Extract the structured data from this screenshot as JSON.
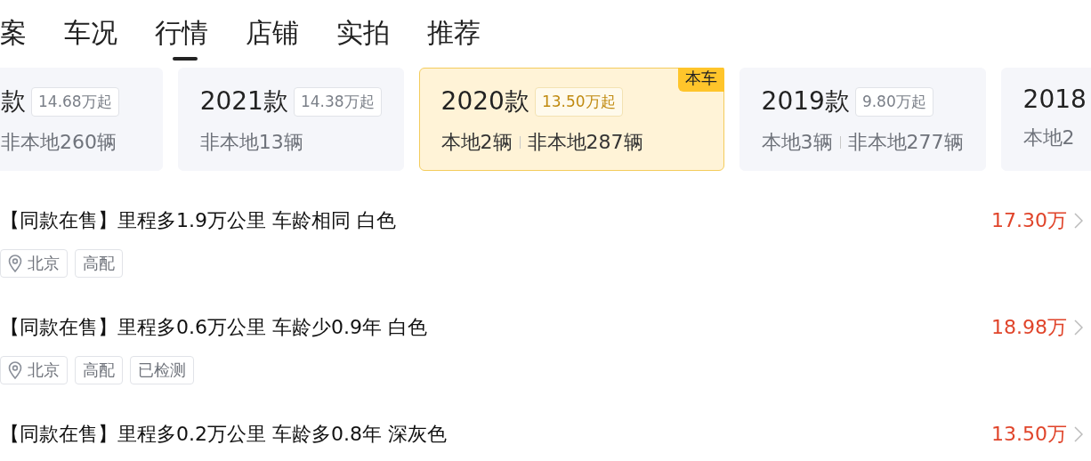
{
  "tabs": [
    {
      "label": "案",
      "selected": false
    },
    {
      "label": "车况",
      "selected": false
    },
    {
      "label": "行情",
      "selected": true
    },
    {
      "label": "店铺",
      "selected": false
    },
    {
      "label": "实拍",
      "selected": false
    },
    {
      "label": "推荐",
      "selected": false
    }
  ],
  "model_years": [
    {
      "title": "款",
      "price": "14.68万起",
      "counts": [
        "非本地260辆"
      ],
      "selected": false
    },
    {
      "title": "2021款",
      "price": "14.38万起",
      "counts": [
        "非本地13辆"
      ],
      "selected": false
    },
    {
      "title": "2020款",
      "price": "13.50万起",
      "counts": [
        "本地2辆",
        "非本地287辆"
      ],
      "selected": true,
      "badge": "本车"
    },
    {
      "title": "2019款",
      "price": "9.80万起",
      "counts": [
        "本地3辆",
        "非本地277辆"
      ],
      "selected": false
    },
    {
      "title": "2018",
      "counts": [
        "本地2"
      ],
      "selected": false
    }
  ],
  "listings": [
    {
      "title": "【同款在售】里程多1.9万公里 车龄相同 白色",
      "price": "17.30万",
      "tags": [
        {
          "kind": "location",
          "label": "北京"
        },
        {
          "kind": "plain",
          "label": "高配"
        }
      ]
    },
    {
      "title": "【同款在售】里程多0.6万公里 车龄少0.9年 白色",
      "price": "18.98万",
      "tags": [
        {
          "kind": "location",
          "label": "北京"
        },
        {
          "kind": "plain",
          "label": "高配"
        },
        {
          "kind": "plain",
          "label": "已检测"
        }
      ]
    },
    {
      "title": "【同款在售】里程多0.2万公里 车龄多0.8年 深灰色",
      "price": "13.50万"
    }
  ]
}
